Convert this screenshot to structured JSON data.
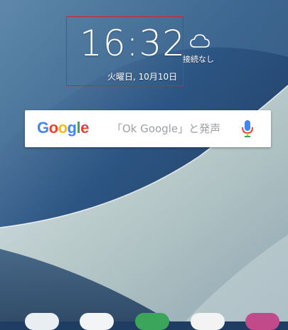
{
  "clock": {
    "time": "16:32",
    "date": "火曜日, 10月10日"
  },
  "weather": {
    "icon": "cloud-icon",
    "status": "接続なし"
  },
  "search": {
    "logo_letters": [
      "G",
      "o",
      "o",
      "g",
      "l",
      "e"
    ],
    "logo_colors": [
      "#4285F4",
      "#EA4335",
      "#FBBC05",
      "#4285F4",
      "#34A853",
      "#EA4335"
    ],
    "hint": "「Ok Google」と発声",
    "mic_icon": "microphone-icon"
  },
  "highlight_color": "#e0201f",
  "dock": {
    "icons": [
      "app-icon-1",
      "app-icon-2",
      "app-icon-3",
      "app-icon-4",
      "app-icon-5"
    ]
  }
}
